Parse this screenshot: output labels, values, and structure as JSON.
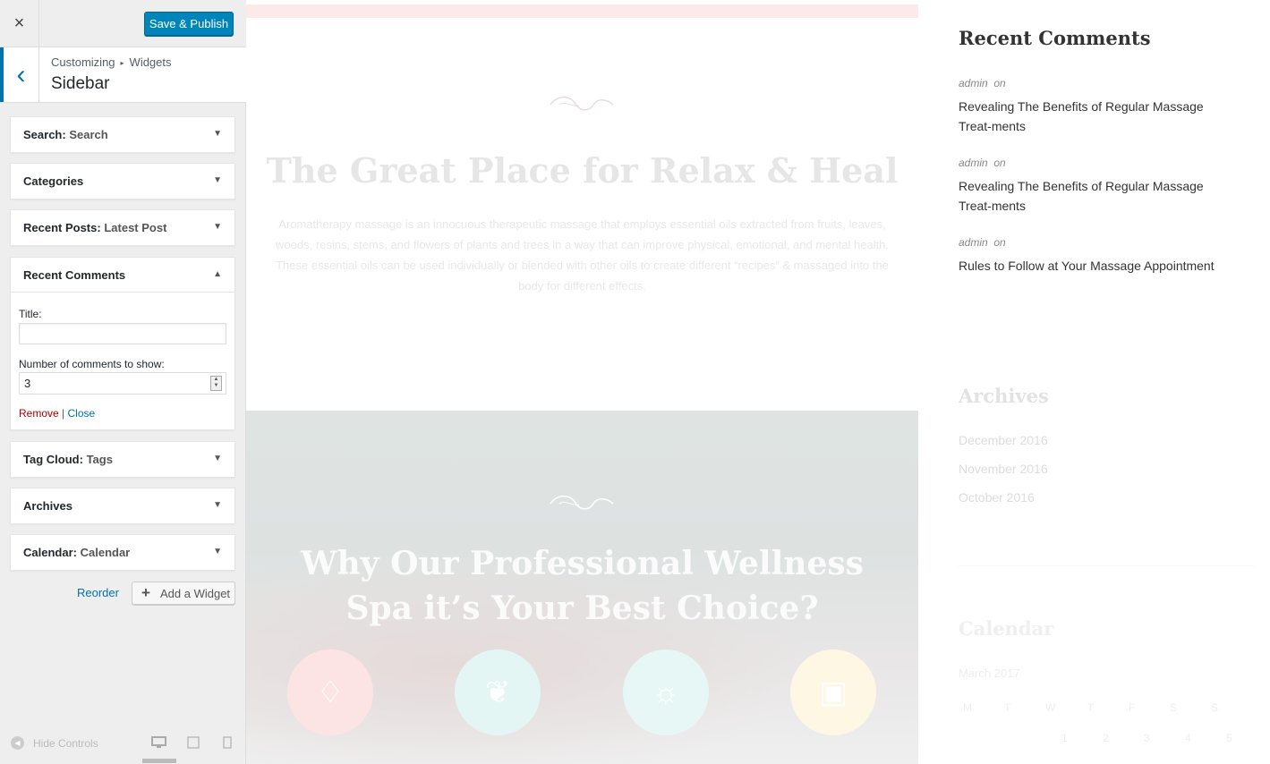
{
  "panel": {
    "close_icon": "×",
    "publish_label": "Save & Publish",
    "breadcrumb": [
      "Customizing",
      "Widgets"
    ],
    "breadcrumb_sep": "▸",
    "title": "Sidebar",
    "back_icon": "‹"
  },
  "widgets": [
    {
      "name": "Search",
      "instance": "Search"
    },
    {
      "name": "Categories",
      "instance": ""
    },
    {
      "name": "Recent Posts",
      "instance": "Latest Post"
    },
    {
      "name": "Recent Comments",
      "instance": ""
    },
    {
      "name": "Tag Cloud",
      "instance": "Tags"
    },
    {
      "name": "Archives",
      "instance": ""
    },
    {
      "name": "Calendar",
      "instance": "Calendar"
    }
  ],
  "instance_prefix": ":",
  "recent_comments_form": {
    "title_label": "Title:",
    "title_value": "",
    "number_label": "Number of comments to show:",
    "number_value": "3",
    "remove_label": "Remove",
    "separator": "|",
    "close_label": "Close"
  },
  "footer": {
    "reorder_label": "Reorder",
    "add_widget_label": "Add a Widget",
    "hide_controls_label": "Hide Controls"
  },
  "preview": {
    "hero_title": "The Great Place for Relax & Heal",
    "hero_text": "Aromatherapy massage is an innocuous therapeutic massage that employs essential oils extracted from fruits, leaves, woods, resins, stems, and flowers of plants and trees in a way that can improve physical, emotional, and mental health. These essential oils can be used individually or blended with other oils to create different “recipes” & massaged into the body for different effects.",
    "spa_title": "Why Our Professional Wellness Spa it’s Your Best Choice?",
    "spa_icons": [
      {
        "icon": "diamond-icon",
        "glyph": "♢",
        "color": "#fde4e4"
      },
      {
        "icon": "leaf-icon",
        "glyph": "❦",
        "color": "#e4f6f3"
      },
      {
        "icon": "sun-icon",
        "glyph": "☼",
        "color": "#e6f7f5"
      },
      {
        "icon": "gift-icon",
        "glyph": "▣",
        "color": "#fdf7e4"
      }
    ],
    "sidebar": {
      "recent_comments_heading": "Recent Comments",
      "comments": [
        {
          "author": "admin",
          "on": "on",
          "post": "Revealing The Benefits of Regular Massage Treat-ments"
        },
        {
          "author": "admin",
          "on": "on",
          "post": "Revealing The Benefits of Regular Massage Treat-ments"
        },
        {
          "author": "admin",
          "on": "on",
          "post": "Rules to Follow at Your Massage Appointment"
        }
      ],
      "archives_heading": "Archives",
      "archives": [
        "December 2016",
        "November 2016",
        "October 2016"
      ],
      "calendar_heading": "Calendar",
      "calendar_month": "March 2017",
      "calendar_days": [
        "M",
        "T",
        "W",
        "T",
        "F",
        "S",
        "S"
      ],
      "calendar_first_row": [
        "1",
        "2",
        "3",
        "4",
        "5"
      ]
    }
  }
}
